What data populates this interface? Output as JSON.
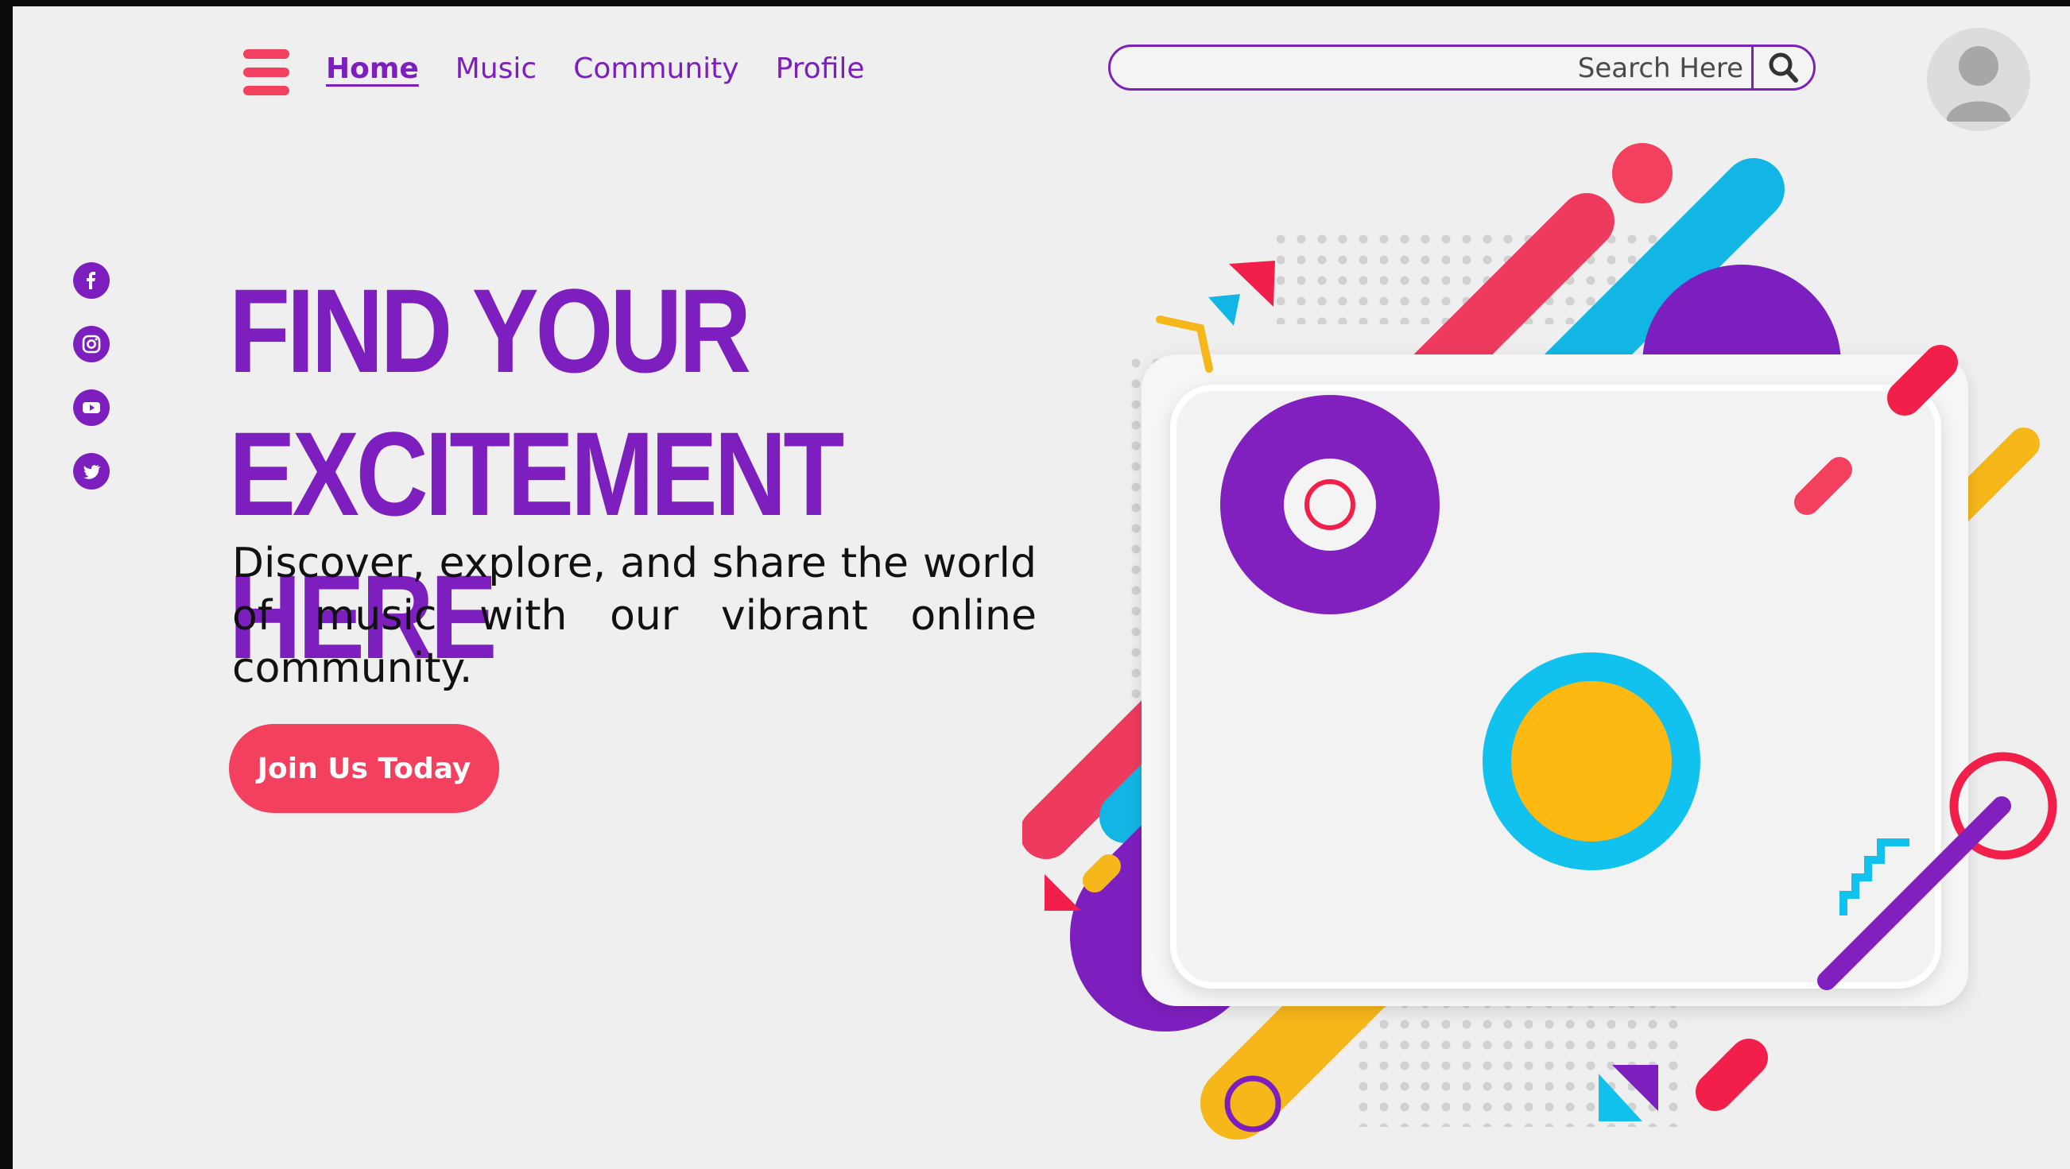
{
  "header": {
    "nav": [
      {
        "label": "Home",
        "active": true
      },
      {
        "label": "Music",
        "active": false
      },
      {
        "label": "Community",
        "active": false
      },
      {
        "label": "Profile",
        "active": false
      }
    ],
    "search": {
      "placeholder": "Search Here"
    },
    "icons": {
      "menu": "hamburger-menu-icon",
      "search": "magnifier-icon",
      "avatar": "user-avatar-icon"
    }
  },
  "social": {
    "icons": [
      "facebook-icon",
      "instagram-icon",
      "youtube-icon",
      "twitter-icon"
    ]
  },
  "hero": {
    "title_line1": "FIND YOUR",
    "title_line2": "EXCITEMENT HERE",
    "description": "Discover, explore, and share the world of music with our vibrant online community.",
    "cta_label": "Join Us Today"
  },
  "colors": {
    "purple": "#7d1fbf",
    "pink": "#f2405e",
    "red": "#f21f4a",
    "cyan": "#11b8e6",
    "yellow": "#f6b71a",
    "gray": "#a5a7a8",
    "background": "#efefef"
  }
}
